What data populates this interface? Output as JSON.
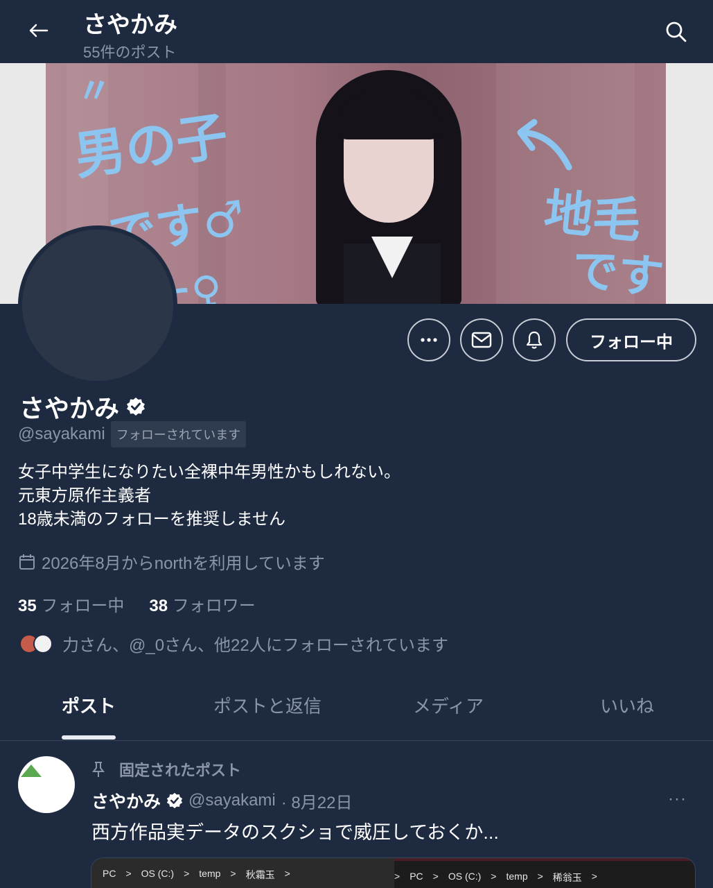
{
  "header": {
    "title": "さやかみ",
    "post_count": "55件のポスト"
  },
  "banner": {
    "text_left_1": "男の子",
    "text_left_2": "です♂",
    "text_left_3": "た♀",
    "text_right_1": "地毛",
    "text_right_2": "です"
  },
  "actions": {
    "follow_label": "フォロー中"
  },
  "profile": {
    "name": "さやかみ",
    "handle": "@sayakami",
    "follows_you": "フォローされています",
    "bio": [
      "女子中学生になりたい全裸中年男性かもしれない。",
      "元東方原作主義者",
      "18歳未満のフォローを推奨しません"
    ],
    "joined": "2026年8月からnorthを利用しています",
    "following_count": "35",
    "following_label": "フォロー中",
    "followers_count": "38",
    "followers_label": "フォロワー",
    "followed_by": "力さん、@_0さん、他22人にフォローされています"
  },
  "tabs": [
    "ポスト",
    "ポストと返信",
    "メディア",
    "いいね"
  ],
  "pinned_post": {
    "pinned_label": "固定されたポスト",
    "name": "さやかみ",
    "handle": "@sayakami",
    "date": "· 8月22日",
    "text": "西方作品実データのスクショで威圧しておくか...",
    "more": "···",
    "media_left": [
      "PC",
      ">",
      "OS (C:)",
      ">",
      "temp",
      ">",
      "秋霜玉",
      ">"
    ],
    "media_right": [
      ">",
      "PC",
      ">",
      "OS (C:)",
      ">",
      "temp",
      ">",
      "稀翁玉",
      ">"
    ]
  },
  "colors": {
    "background": "#1e2a40",
    "muted_text": "#8a95a8",
    "banner_text": "#8cc6f0"
  }
}
